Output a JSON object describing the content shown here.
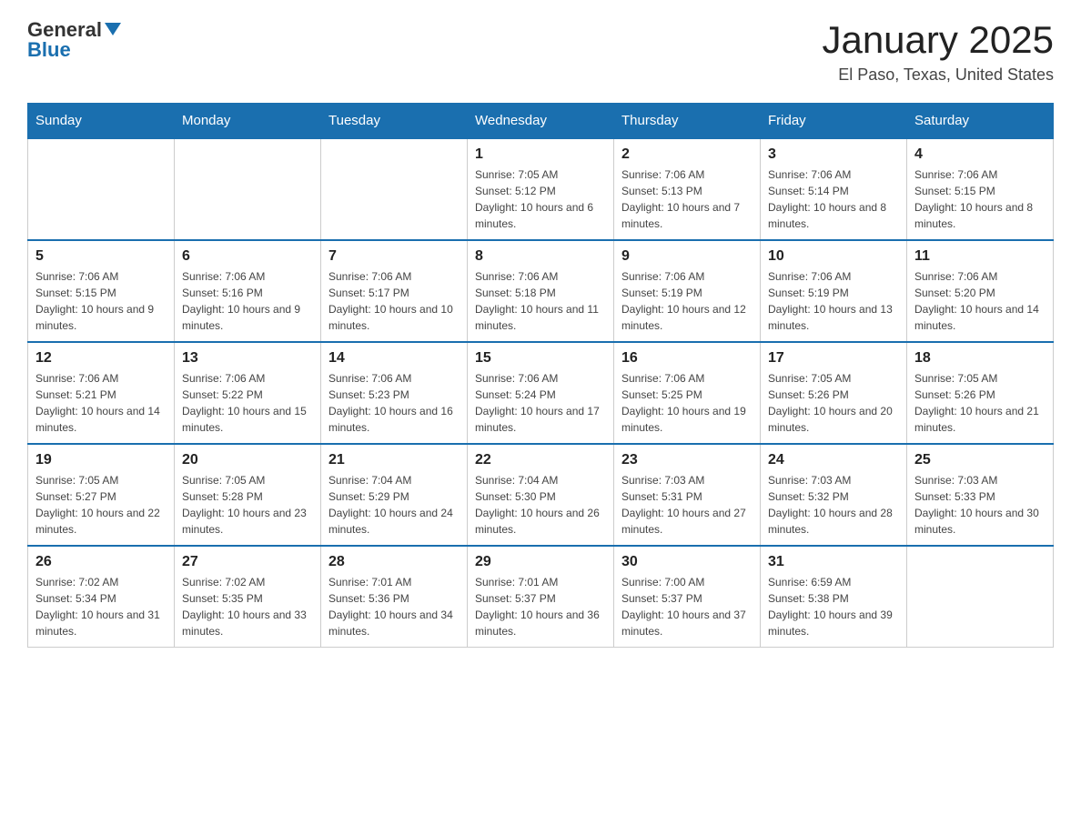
{
  "header": {
    "logo_general": "General",
    "logo_blue": "Blue",
    "month": "January 2025",
    "location": "El Paso, Texas, United States"
  },
  "days_of_week": [
    "Sunday",
    "Monday",
    "Tuesday",
    "Wednesday",
    "Thursday",
    "Friday",
    "Saturday"
  ],
  "weeks": [
    [
      {
        "day": "",
        "info": ""
      },
      {
        "day": "",
        "info": ""
      },
      {
        "day": "",
        "info": ""
      },
      {
        "day": "1",
        "info": "Sunrise: 7:05 AM\nSunset: 5:12 PM\nDaylight: 10 hours and 6 minutes."
      },
      {
        "day": "2",
        "info": "Sunrise: 7:06 AM\nSunset: 5:13 PM\nDaylight: 10 hours and 7 minutes."
      },
      {
        "day": "3",
        "info": "Sunrise: 7:06 AM\nSunset: 5:14 PM\nDaylight: 10 hours and 8 minutes."
      },
      {
        "day": "4",
        "info": "Sunrise: 7:06 AM\nSunset: 5:15 PM\nDaylight: 10 hours and 8 minutes."
      }
    ],
    [
      {
        "day": "5",
        "info": "Sunrise: 7:06 AM\nSunset: 5:15 PM\nDaylight: 10 hours and 9 minutes."
      },
      {
        "day": "6",
        "info": "Sunrise: 7:06 AM\nSunset: 5:16 PM\nDaylight: 10 hours and 9 minutes."
      },
      {
        "day": "7",
        "info": "Sunrise: 7:06 AM\nSunset: 5:17 PM\nDaylight: 10 hours and 10 minutes."
      },
      {
        "day": "8",
        "info": "Sunrise: 7:06 AM\nSunset: 5:18 PM\nDaylight: 10 hours and 11 minutes."
      },
      {
        "day": "9",
        "info": "Sunrise: 7:06 AM\nSunset: 5:19 PM\nDaylight: 10 hours and 12 minutes."
      },
      {
        "day": "10",
        "info": "Sunrise: 7:06 AM\nSunset: 5:19 PM\nDaylight: 10 hours and 13 minutes."
      },
      {
        "day": "11",
        "info": "Sunrise: 7:06 AM\nSunset: 5:20 PM\nDaylight: 10 hours and 14 minutes."
      }
    ],
    [
      {
        "day": "12",
        "info": "Sunrise: 7:06 AM\nSunset: 5:21 PM\nDaylight: 10 hours and 14 minutes."
      },
      {
        "day": "13",
        "info": "Sunrise: 7:06 AM\nSunset: 5:22 PM\nDaylight: 10 hours and 15 minutes."
      },
      {
        "day": "14",
        "info": "Sunrise: 7:06 AM\nSunset: 5:23 PM\nDaylight: 10 hours and 16 minutes."
      },
      {
        "day": "15",
        "info": "Sunrise: 7:06 AM\nSunset: 5:24 PM\nDaylight: 10 hours and 17 minutes."
      },
      {
        "day": "16",
        "info": "Sunrise: 7:06 AM\nSunset: 5:25 PM\nDaylight: 10 hours and 19 minutes."
      },
      {
        "day": "17",
        "info": "Sunrise: 7:05 AM\nSunset: 5:26 PM\nDaylight: 10 hours and 20 minutes."
      },
      {
        "day": "18",
        "info": "Sunrise: 7:05 AM\nSunset: 5:26 PM\nDaylight: 10 hours and 21 minutes."
      }
    ],
    [
      {
        "day": "19",
        "info": "Sunrise: 7:05 AM\nSunset: 5:27 PM\nDaylight: 10 hours and 22 minutes."
      },
      {
        "day": "20",
        "info": "Sunrise: 7:05 AM\nSunset: 5:28 PM\nDaylight: 10 hours and 23 minutes."
      },
      {
        "day": "21",
        "info": "Sunrise: 7:04 AM\nSunset: 5:29 PM\nDaylight: 10 hours and 24 minutes."
      },
      {
        "day": "22",
        "info": "Sunrise: 7:04 AM\nSunset: 5:30 PM\nDaylight: 10 hours and 26 minutes."
      },
      {
        "day": "23",
        "info": "Sunrise: 7:03 AM\nSunset: 5:31 PM\nDaylight: 10 hours and 27 minutes."
      },
      {
        "day": "24",
        "info": "Sunrise: 7:03 AM\nSunset: 5:32 PM\nDaylight: 10 hours and 28 minutes."
      },
      {
        "day": "25",
        "info": "Sunrise: 7:03 AM\nSunset: 5:33 PM\nDaylight: 10 hours and 30 minutes."
      }
    ],
    [
      {
        "day": "26",
        "info": "Sunrise: 7:02 AM\nSunset: 5:34 PM\nDaylight: 10 hours and 31 minutes."
      },
      {
        "day": "27",
        "info": "Sunrise: 7:02 AM\nSunset: 5:35 PM\nDaylight: 10 hours and 33 minutes."
      },
      {
        "day": "28",
        "info": "Sunrise: 7:01 AM\nSunset: 5:36 PM\nDaylight: 10 hours and 34 minutes."
      },
      {
        "day": "29",
        "info": "Sunrise: 7:01 AM\nSunset: 5:37 PM\nDaylight: 10 hours and 36 minutes."
      },
      {
        "day": "30",
        "info": "Sunrise: 7:00 AM\nSunset: 5:37 PM\nDaylight: 10 hours and 37 minutes."
      },
      {
        "day": "31",
        "info": "Sunrise: 6:59 AM\nSunset: 5:38 PM\nDaylight: 10 hours and 39 minutes."
      },
      {
        "day": "",
        "info": ""
      }
    ]
  ]
}
